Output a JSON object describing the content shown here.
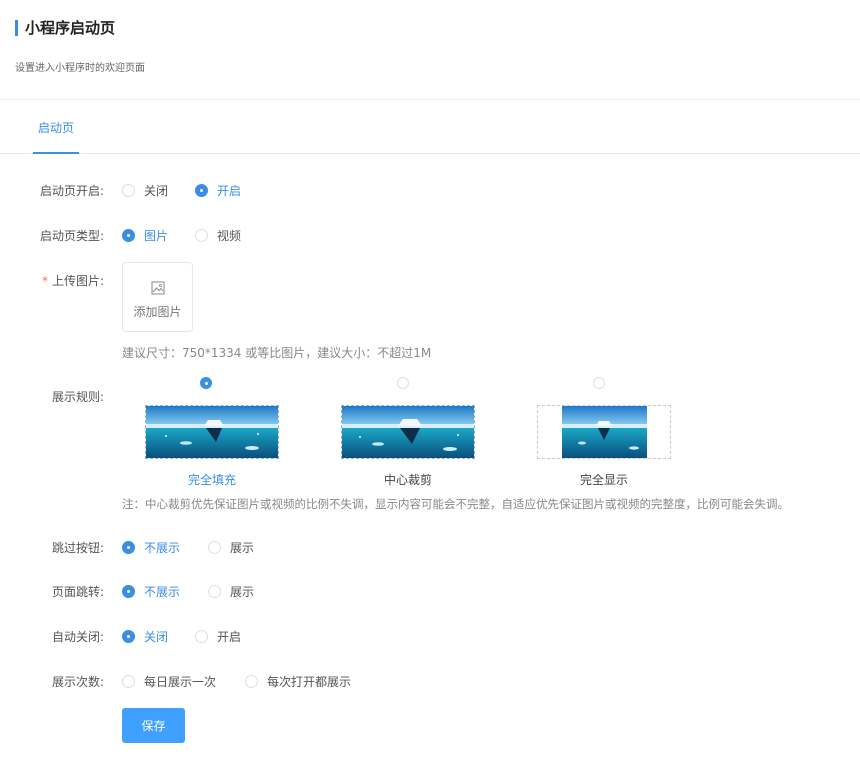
{
  "header": {
    "title": "小程序启动页",
    "subtitle": "设置进入小程序时的欢迎页面",
    "accent_color": "#3a8ee6"
  },
  "tabs": [
    {
      "label": "启动页",
      "active": true
    }
  ],
  "form": {
    "enable": {
      "label": "启动页开启:",
      "options": [
        {
          "label": "关闭",
          "checked": false
        },
        {
          "label": "开启",
          "checked": true
        }
      ]
    },
    "type": {
      "label": "启动页类型:",
      "options": [
        {
          "label": "图片",
          "checked": true
        },
        {
          "label": "视频",
          "checked": false
        }
      ]
    },
    "upload": {
      "required_mark": "*",
      "label": "上传图片:",
      "button_text": "添加图片",
      "icon": "image-icon",
      "hint": "建议尺寸：750*1334 或等比图片，建议大小：不超过1M"
    },
    "display_rule": {
      "label": "展示规则:",
      "modes": [
        {
          "label": "完全填充",
          "checked": true
        },
        {
          "label": "中心裁剪",
          "checked": false
        },
        {
          "label": "完全显示",
          "checked": false
        }
      ],
      "note": "注：中心裁剪优先保证图片或视频的比例不失调，显示内容可能会不完整，自适应优先保证图片或视频的完整度，比例可能会失调。"
    },
    "skip_button": {
      "label": "跳过按钮:",
      "options": [
        {
          "label": "不展示",
          "checked": true
        },
        {
          "label": "展示",
          "checked": false
        }
      ]
    },
    "page_jump": {
      "label": "页面跳转:",
      "options": [
        {
          "label": "不展示",
          "checked": true
        },
        {
          "label": "展示",
          "checked": false
        }
      ]
    },
    "auto_close": {
      "label": "自动关闭:",
      "options": [
        {
          "label": "关闭",
          "checked": true
        },
        {
          "label": "开启",
          "checked": false
        }
      ]
    },
    "show_count": {
      "label": "展示次数:",
      "options": [
        {
          "label": "每日展示一次",
          "checked": false
        },
        {
          "label": "每次打开都展示",
          "checked": false
        }
      ]
    },
    "save_button": "保存"
  }
}
